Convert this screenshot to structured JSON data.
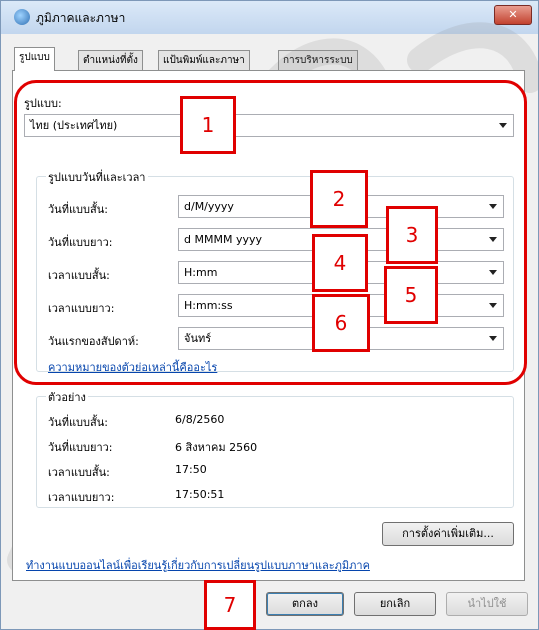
{
  "window": {
    "title": "ภูมิภาคและภาษา",
    "close_glyph": "✕"
  },
  "tabs": [
    "รูปแบบ",
    "ตำแหน่งที่ตั้ง",
    "แป้นพิมพ์และภาษา",
    "การบริหารระบบ"
  ],
  "format": {
    "label": "รูปแบบ:",
    "value": "ไทย (ประเทศไทย)"
  },
  "date_time_group": {
    "title": "รูปแบบวันที่และเวลา",
    "rows": [
      {
        "label": "วันที่แบบสั้น:",
        "value": "d/M/yyyy"
      },
      {
        "label": "วันที่แบบยาว:",
        "value": "d MMMM yyyy"
      },
      {
        "label": "เวลาแบบสั้น:",
        "value": "H:mm"
      },
      {
        "label": "เวลาแบบยาว:",
        "value": "H:mm:ss"
      },
      {
        "label": "วันแรกของสัปดาห์:",
        "value": "จันทร์"
      }
    ],
    "link": "ความหมายของตัวย่อเหล่านี้คืออะไร"
  },
  "examples": {
    "title": "ตัวอย่าง",
    "rows": [
      {
        "label": "วันที่แบบสั้น:",
        "value": "6/8/2560"
      },
      {
        "label": "วันที่แบบยาว:",
        "value": "6 สิงหาคม 2560"
      },
      {
        "label": "เวลาแบบสั้น:",
        "value": "17:50"
      },
      {
        "label": "เวลาแบบยาว:",
        "value": "17:50:51"
      }
    ]
  },
  "additional_settings_button": "การตั้งค่าเพิ่มเติม...",
  "online_link": "ทำงานแบบออนไลน์เพื่อเรียนรู้เกี่ยวกับการเปลี่ยนรูปแบบภาษาและภูมิภาค",
  "buttons": {
    "ok": "ตกลง",
    "cancel": "ยกเลิก",
    "apply": "นำไปใช้"
  },
  "annotations": [
    "1",
    "2",
    "3",
    "4",
    "5",
    "6",
    "7"
  ],
  "colors": {
    "annotation_red": "#e00000",
    "link_blue": "#0645ad",
    "title_gradient_top": "#dbe9f8"
  }
}
